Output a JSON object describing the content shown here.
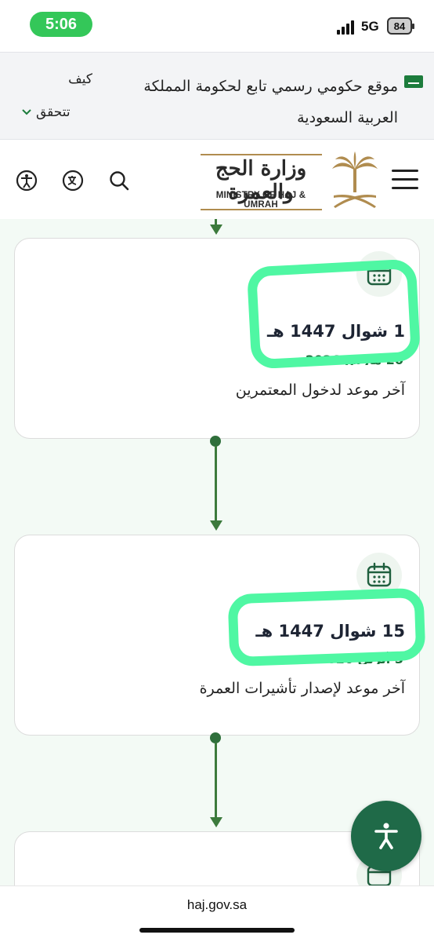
{
  "status": {
    "time": "5:06",
    "network": "5G",
    "battery": "84"
  },
  "gov_banner": {
    "text": "موقع حكومي رسمي تابع لحكومة المملكة العربية السعودية",
    "how": "كيف",
    "verify": "تتحقق"
  },
  "header": {
    "logo_ar": "وزارة الحج والعمرة",
    "logo_en": "MINISTRY OF HAJ & UMRAH"
  },
  "timeline": [
    {
      "hijri": "1 شوال 1447 هـ",
      "gregorian": "20 مارس 2026",
      "description": "آخر موعد لدخول المعتمرين"
    },
    {
      "hijri": "15 شوال 1447 هـ",
      "gregorian": "3 أبريل 2026",
      "description": "آخر موعد لإصدار تأشيرات العمرة"
    }
  ],
  "browser": {
    "url": "haj.gov.sa"
  },
  "colors": {
    "brand_green": "#1f6a48",
    "highlight": "#4ff7a3",
    "timeline": "#3c7a3c"
  }
}
